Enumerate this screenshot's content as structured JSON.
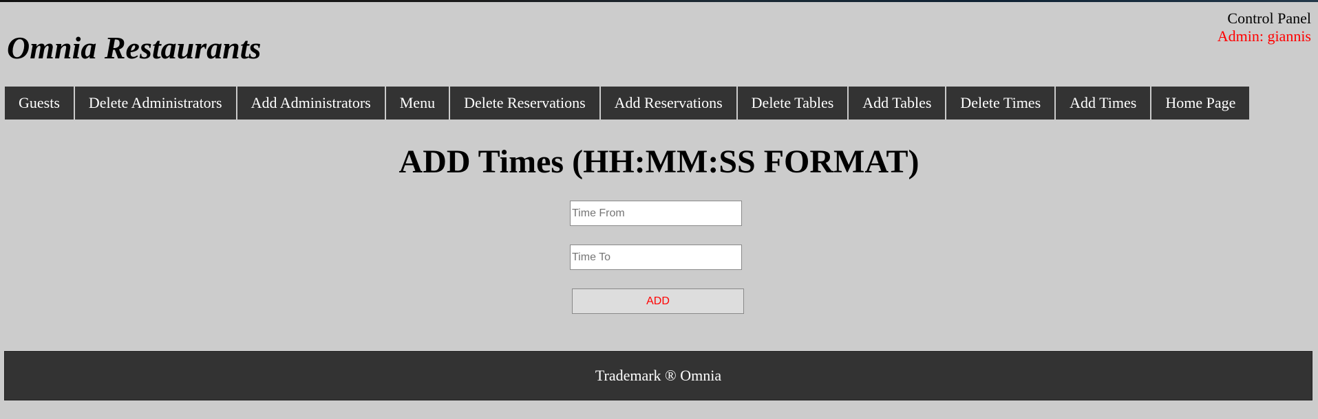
{
  "header": {
    "brand": "Omnia Restaurants",
    "control_panel": "Control Panel",
    "admin_label": "Admin: giannis"
  },
  "nav": {
    "items": [
      {
        "label": "Guests"
      },
      {
        "label": "Delete Administrators"
      },
      {
        "label": "Add Administrators"
      },
      {
        "label": "Menu"
      },
      {
        "label": "Delete Reservations"
      },
      {
        "label": "Add Reservations"
      },
      {
        "label": "Delete Tables"
      },
      {
        "label": "Add Tables"
      },
      {
        "label": "Delete Times"
      },
      {
        "label": "Add Times"
      },
      {
        "label": "Home Page"
      }
    ]
  },
  "main": {
    "title": "ADD Times (HH:MM:SS FORMAT)",
    "time_from": {
      "value": "",
      "placeholder": "Time From"
    },
    "time_to": {
      "value": "",
      "placeholder": "Time To"
    },
    "add_label": "ADD"
  },
  "footer": {
    "text": "Trademark ® Omnia"
  },
  "colors": {
    "background": "#cccccc",
    "nav_background": "#333333",
    "nav_text": "#ffffff",
    "accent_red": "#ff0000"
  }
}
